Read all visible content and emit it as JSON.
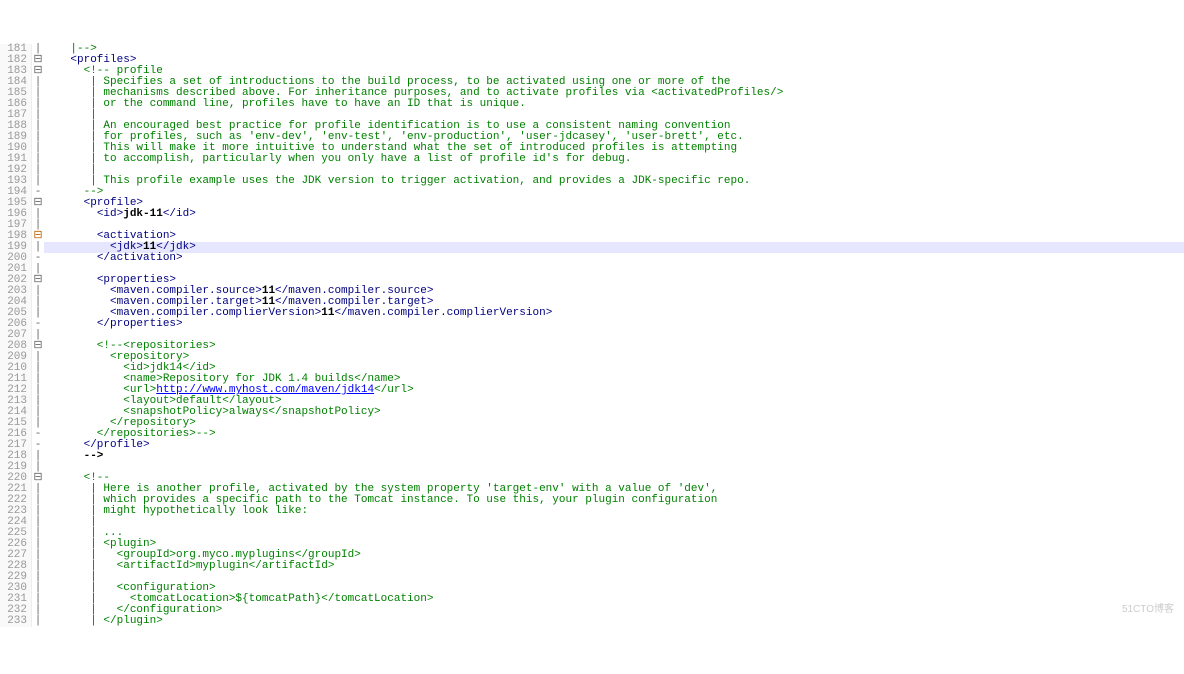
{
  "lines": [
    {
      "ln": 181,
      "icon": "|",
      "type": "comment",
      "indent": 2,
      "text": "|-->"
    },
    {
      "ln": 182,
      "icon": "⊟",
      "type": "tag",
      "indent": 2,
      "open": "<profiles>",
      "close": ""
    },
    {
      "ln": 183,
      "icon": "⊟",
      "type": "comment",
      "indent": 3,
      "text": "<!-- profile"
    },
    {
      "ln": 184,
      "icon": "|",
      "type": "comment",
      "indent": 3,
      "text": " | Specifies a set of introductions to the build process, to be activated using one or more of the"
    },
    {
      "ln": 185,
      "icon": "|",
      "type": "comment",
      "indent": 3,
      "text": " | mechanisms described above. For inheritance purposes, and to activate profiles via <activatedProfiles/>"
    },
    {
      "ln": 186,
      "icon": "|",
      "type": "comment",
      "indent": 3,
      "text": " | or the command line, profiles have to have an ID that is unique."
    },
    {
      "ln": 187,
      "icon": "|",
      "type": "comment",
      "indent": 3,
      "text": " |"
    },
    {
      "ln": 188,
      "icon": "|",
      "type": "comment",
      "indent": 3,
      "text": " | An encouraged best practice for profile identification is to use a consistent naming convention"
    },
    {
      "ln": 189,
      "icon": "|",
      "type": "comment",
      "indent": 3,
      "text": " | for profiles, such as 'env-dev', 'env-test', 'env-production', 'user-jdcasey', 'user-brett', etc."
    },
    {
      "ln": 190,
      "icon": "|",
      "type": "comment",
      "indent": 3,
      "text": " | This will make it more intuitive to understand what the set of introduced profiles is attempting"
    },
    {
      "ln": 191,
      "icon": "|",
      "type": "comment",
      "indent": 3,
      "text": " | to accomplish, particularly when you only have a list of profile id's for debug."
    },
    {
      "ln": 192,
      "icon": "|",
      "type": "comment",
      "indent": 3,
      "text": " |"
    },
    {
      "ln": 193,
      "icon": "|",
      "type": "comment",
      "indent": 3,
      "text": " | This profile example uses the JDK version to trigger activation, and provides a JDK-specific repo."
    },
    {
      "ln": 194,
      "icon": "-",
      "type": "comment",
      "indent": 3,
      "text": "-->"
    },
    {
      "ln": 195,
      "icon": "⊟",
      "type": "tag",
      "indent": 3,
      "open": "<profile>",
      "close": ""
    },
    {
      "ln": 196,
      "icon": "|",
      "type": "elem",
      "indent": 4,
      "open": "<id>",
      "val": "jdk-11",
      "close": "</id>"
    },
    {
      "ln": 197,
      "icon": "|",
      "type": "blank",
      "indent": 0,
      "text": ""
    },
    {
      "ln": 198,
      "icon": "⊟",
      "type": "tag",
      "indent": 4,
      "open": "<activation>",
      "close": "",
      "warn": true
    },
    {
      "ln": 199,
      "icon": "|",
      "type": "elem",
      "indent": 5,
      "open": "<jdk>",
      "val": "11",
      "close": "</jdk>",
      "hl": true
    },
    {
      "ln": 200,
      "icon": "-",
      "type": "tag",
      "indent": 4,
      "open": "</activation>",
      "close": ""
    },
    {
      "ln": 201,
      "icon": "|",
      "type": "blank",
      "indent": 0,
      "text": ""
    },
    {
      "ln": 202,
      "icon": "⊟",
      "type": "tag",
      "indent": 4,
      "open": "<properties>",
      "close": ""
    },
    {
      "ln": 203,
      "icon": "|",
      "type": "elem",
      "indent": 5,
      "open": "<maven.compiler.source>",
      "val": "11",
      "close": "</maven.compiler.source>"
    },
    {
      "ln": 204,
      "icon": "|",
      "type": "elem",
      "indent": 5,
      "open": "<maven.compiler.target>",
      "val": "11",
      "close": "</maven.compiler.target>"
    },
    {
      "ln": 205,
      "icon": "|",
      "type": "elem",
      "indent": 5,
      "open": "<maven.compiler.complierVersion>",
      "val": "11",
      "close": "</maven.compiler.complierVersion>"
    },
    {
      "ln": 206,
      "icon": "-",
      "type": "tag",
      "indent": 4,
      "open": "</properties>",
      "close": ""
    },
    {
      "ln": 207,
      "icon": "|",
      "type": "blank",
      "indent": 0,
      "text": ""
    },
    {
      "ln": 208,
      "icon": "⊟",
      "type": "comment",
      "indent": 4,
      "text": "<!--<repositories>"
    },
    {
      "ln": 209,
      "icon": "|",
      "type": "comment",
      "indent": 5,
      "text": "<repository>"
    },
    {
      "ln": 210,
      "icon": "|",
      "type": "comment",
      "indent": 6,
      "text": "<id>jdk14</id>"
    },
    {
      "ln": 211,
      "icon": "|",
      "type": "comment",
      "indent": 6,
      "text": "<name>Repository for JDK 1.4 builds</name>"
    },
    {
      "ln": 212,
      "icon": "|",
      "type": "urlline",
      "indent": 6,
      "pre": "<url>",
      "url": "http://www.myhost.com/maven/jdk14",
      "post": "</url>"
    },
    {
      "ln": 213,
      "icon": "|",
      "type": "comment",
      "indent": 6,
      "text": "<layout>default</layout>"
    },
    {
      "ln": 214,
      "icon": "|",
      "type": "comment",
      "indent": 6,
      "text": "<snapshotPolicy>always</snapshotPolicy>"
    },
    {
      "ln": 215,
      "icon": "|",
      "type": "comment",
      "indent": 5,
      "text": "</repository>"
    },
    {
      "ln": 216,
      "icon": "-",
      "type": "comment",
      "indent": 4,
      "text": "</repositories>-->"
    },
    {
      "ln": 217,
      "icon": "-",
      "type": "tag",
      "indent": 3,
      "open": "</profile>",
      "close": ""
    },
    {
      "ln": 218,
      "icon": "|",
      "type": "text",
      "indent": 3,
      "val": "-->"
    },
    {
      "ln": 219,
      "icon": "|",
      "type": "blank",
      "indent": 0,
      "text": ""
    },
    {
      "ln": 220,
      "icon": "⊟",
      "type": "comment",
      "indent": 3,
      "text": "<!--"
    },
    {
      "ln": 221,
      "icon": "|",
      "type": "comment",
      "indent": 3,
      "text": " | Here is another profile, activated by the system property 'target-env' with a value of 'dev',"
    },
    {
      "ln": 222,
      "icon": "|",
      "type": "comment",
      "indent": 3,
      "text": " | which provides a specific path to the Tomcat instance. To use this, your plugin configuration"
    },
    {
      "ln": 223,
      "icon": "|",
      "type": "comment",
      "indent": 3,
      "text": " | might hypothetically look like:"
    },
    {
      "ln": 224,
      "icon": "|",
      "type": "comment",
      "indent": 3,
      "text": " |"
    },
    {
      "ln": 225,
      "icon": "|",
      "type": "comment",
      "indent": 3,
      "text": " | ..."
    },
    {
      "ln": 226,
      "icon": "|",
      "type": "comment",
      "indent": 3,
      "text": " | <plugin>"
    },
    {
      "ln": 227,
      "icon": "|",
      "type": "comment",
      "indent": 3,
      "text": " |   <groupId>org.myco.myplugins</groupId>"
    },
    {
      "ln": 228,
      "icon": "|",
      "type": "comment",
      "indent": 3,
      "text": " |   <artifactId>myplugin</artifactId>"
    },
    {
      "ln": 229,
      "icon": "|",
      "type": "comment",
      "indent": 3,
      "text": " |"
    },
    {
      "ln": 230,
      "icon": "|",
      "type": "comment",
      "indent": 3,
      "text": " |   <configuration>"
    },
    {
      "ln": 231,
      "icon": "|",
      "type": "comment",
      "indent": 3,
      "text": " |     <tomcatLocation>${tomcatPath}</tomcatLocation>"
    },
    {
      "ln": 232,
      "icon": "|",
      "type": "comment",
      "indent": 3,
      "text": " |   </configuration>"
    },
    {
      "ln": 233,
      "icon": "|",
      "type": "comment",
      "indent": 3,
      "text": " | </plugin>"
    }
  ],
  "watermark": "51CTO博客"
}
